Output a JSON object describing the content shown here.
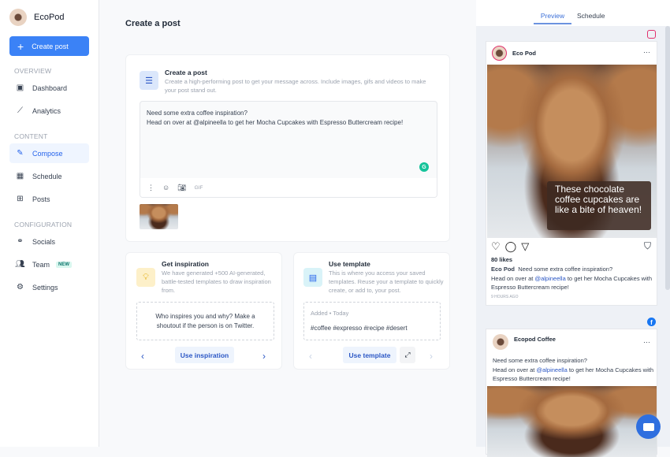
{
  "sidebar": {
    "brand": "EcoPod",
    "create_post": "Create post",
    "sections": {
      "overview": "OVERVIEW",
      "content": "CONTENT",
      "configuration": "CONFIGURATION"
    },
    "items": [
      {
        "label": "Dashboard",
        "icon": "dashboard-icon"
      },
      {
        "label": "Analytics",
        "icon": "analytics-icon"
      },
      {
        "label": "Compose",
        "icon": "compose-icon",
        "active": true
      },
      {
        "label": "Schedule",
        "icon": "calendar-icon"
      },
      {
        "label": "Posts",
        "icon": "grid-icon"
      },
      {
        "label": "Socials",
        "icon": "socials-icon"
      },
      {
        "label": "Team",
        "icon": "team-icon",
        "badge": "NEW"
      },
      {
        "label": "Settings",
        "icon": "gear-icon"
      }
    ]
  },
  "main": {
    "title": "Create a post",
    "composer": {
      "title": "Create a post",
      "description": "Create a high-performing post to get your message across. Include images, gifs and videos to make your post stand out.",
      "line1": "Need some extra coffee inspiration?",
      "line2": "Head on over at @alpineella to get her Mocha Cupcakes with Espresso Buttercream recipe!",
      "gif": "GIF"
    },
    "inspiration": {
      "title": "Get inspiration",
      "description": "We have generated +500 AI-generated, battle-tested templates to draw inspiration from.",
      "prompt": "Who inspires you and why? Make a shoutout if the person is on Twitter.",
      "button": "Use inspiration"
    },
    "template": {
      "title": "Use template",
      "description": "This is where you access your saved templates. Reuse your a template to quickly create, or add to, your post.",
      "meta": "Added • Today",
      "content": "#coffee #expresso #recipe #desert",
      "button": "Use template"
    }
  },
  "preview": {
    "tabs": [
      "Preview",
      "Schedule"
    ],
    "instagram": {
      "name": "Eco Pod",
      "overlay": "These chocolate coffee cupcakes are like a bite of heaven!",
      "likes": "80 likes",
      "caption_name": "Eco Pod",
      "caption_1": "Need some extra coffee inspiration?",
      "caption_2a": "Head on over at ",
      "mention": "@alpineella",
      "caption_2b": " to get her Mocha Cupcakes with Espresso Buttercream recipe!",
      "time": "9 HOURS AGO"
    },
    "facebook": {
      "name": "Ecopod Coffee",
      "line1": "Need some extra coffee inspiration?",
      "line2a": "Head on over at ",
      "mention": "@alpineella",
      "line2b": " to get her Mocha Cupcakes with Espresso Buttercream recipe!"
    }
  },
  "colors": {
    "accent": "#3b82f6",
    "instagram": "#e1306c",
    "facebook": "#1877f2"
  }
}
